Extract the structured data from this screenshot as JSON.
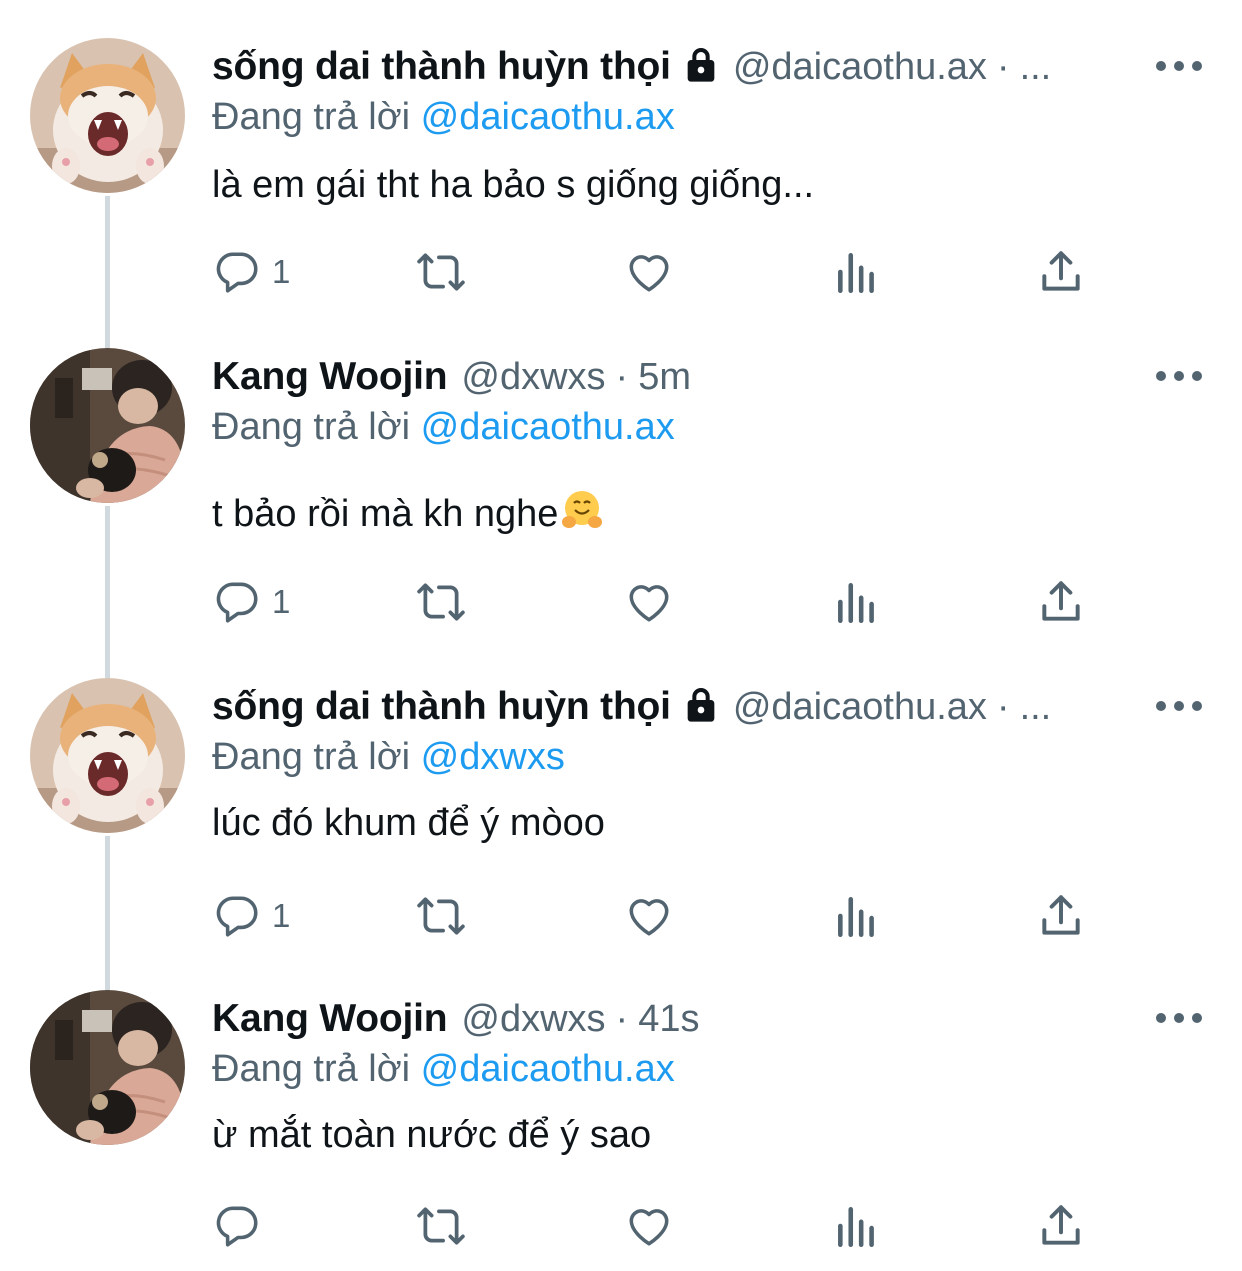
{
  "tweets": [
    {
      "name": "sống dai thành huỳn thọi",
      "locked": true,
      "handle": "@daicaothu.ax",
      "dot": "·",
      "time": "...",
      "replying_prefix": "Đang trả lời",
      "replying_to": "@daicaothu.ax",
      "text": "là em gái tht ha bảo s giống giống...",
      "reply_count": "1",
      "avatar": "cat-avatar"
    },
    {
      "name": "Kang Woojin",
      "locked": false,
      "handle": "@dxwxs",
      "dot": "·",
      "time": "5m",
      "replying_prefix": "Đang trả lời",
      "replying_to": "@daicaothu.ax",
      "text": "t bảo rồi mà kh nghe",
      "text_emoji": "hugging-face-emoji",
      "reply_count": "1",
      "avatar": "person-avatar"
    },
    {
      "name": "sống dai thành huỳn thọi",
      "locked": true,
      "handle": "@daicaothu.ax",
      "dot": "·",
      "time": "...",
      "replying_prefix": "Đang trả lời",
      "replying_to": "@dxwxs",
      "text": "lúc đó khum để ý mòoo",
      "reply_count": "1",
      "avatar": "cat-avatar"
    },
    {
      "name": "Kang Woojin",
      "locked": false,
      "handle": "@dxwxs",
      "dot": "·",
      "time": "41s",
      "replying_prefix": "Đang trả lời",
      "replying_to": "@daicaothu.ax",
      "text": "ừ mắt toàn nước để ý sao",
      "reply_count": "",
      "avatar": "person-avatar"
    }
  ],
  "icons": {
    "reply": "reply-icon",
    "retweet": "retweet-icon",
    "like": "like-icon",
    "views": "views-icon",
    "share": "share-icon",
    "more": "more-icon",
    "lock": "lock-icon"
  },
  "colors": {
    "text": "#0f1419",
    "secondary": "#536471",
    "mention": "#1d9bf0",
    "thread_line": "#cfd9de"
  }
}
